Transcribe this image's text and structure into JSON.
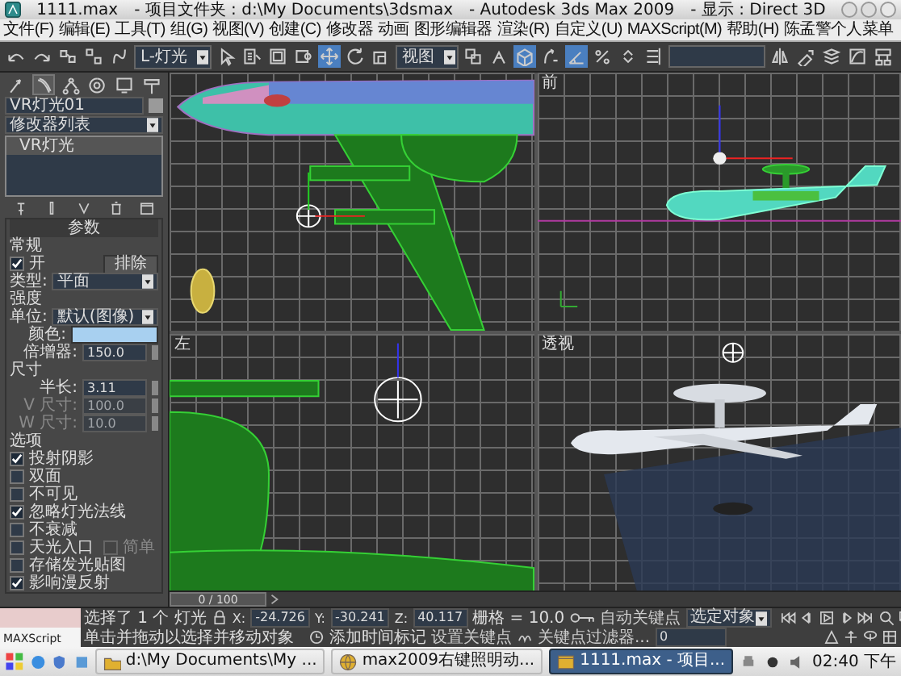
{
  "window": {
    "title_parts": [
      "1111.max",
      "- 项目文件夹 : d:\\My Documents\\3dsmax",
      "- Autodesk 3ds Max  2009",
      "- 显示 : Direct 3D"
    ]
  },
  "menu": [
    "文件(F)",
    "编辑(E)",
    "工具(T)",
    "组(G)",
    "视图(V)",
    "创建(C)",
    "修改器",
    "动画",
    "图形编辑器",
    "渲染(R)",
    "自定义(U)",
    "MAXScript(M)",
    "帮助(H)",
    "陈孟警个人菜单"
  ],
  "toolbar": [
    {
      "kind": "undo",
      "selected": false
    },
    {
      "kind": "redo",
      "selected": false
    },
    {
      "kind": "link",
      "selected": false
    },
    {
      "kind": "unlink",
      "selected": false
    },
    {
      "kind": "bind",
      "selected": false
    },
    {
      "kind": "dropdown",
      "value": "L-灯光"
    },
    {
      "kind": "select",
      "selected": false
    },
    {
      "kind": "select-name",
      "selected": false
    },
    {
      "kind": "region",
      "selected": false
    },
    {
      "kind": "window",
      "selected": false
    },
    {
      "kind": "move",
      "selected": true
    },
    {
      "kind": "rotate",
      "selected": false
    },
    {
      "kind": "scale",
      "selected": false
    },
    {
      "kind": "dropdown",
      "value": "视图"
    },
    {
      "kind": "pivot",
      "selected": false
    },
    {
      "kind": "manipulate",
      "selected": false
    },
    {
      "kind": "keyboard",
      "selected": true
    },
    {
      "kind": "snap",
      "selected": false
    },
    {
      "kind": "angle-snap",
      "selected": true
    },
    {
      "kind": "percent-snap",
      "selected": false
    },
    {
      "kind": "spinner-snap",
      "selected": false
    },
    {
      "kind": "edit-named",
      "selected": false
    },
    {
      "kind": "field"
    },
    {
      "kind": "mirror",
      "selected": false
    },
    {
      "kind": "align",
      "selected": false
    },
    {
      "kind": "layer",
      "selected": false
    },
    {
      "kind": "curve",
      "selected": false
    },
    {
      "kind": "schematic",
      "selected": false
    }
  ],
  "command_panel": {
    "tabs": [
      {
        "kind": "create",
        "selected": false
      },
      {
        "kind": "modify",
        "selected": true
      },
      {
        "kind": "hierarchy",
        "selected": false
      },
      {
        "kind": "motion",
        "selected": false
      },
      {
        "kind": "display",
        "selected": false
      },
      {
        "kind": "utilities",
        "selected": false
      }
    ],
    "object_name": "VR灯光01",
    "modifier_list": "修改器列表",
    "stack": [
      {
        "label": "VR灯光"
      }
    ],
    "rollout": "参数",
    "general": {
      "heading": "常规",
      "on": {
        "label": "开",
        "checked": true
      },
      "exclude": "排除",
      "type_label": "类型:",
      "type": "平面"
    },
    "intensity": {
      "heading": "强度",
      "units_label": "单位:",
      "units": "默认(图像)",
      "color_label": "颜色:",
      "color": "#a8d0f0",
      "multiplier_label": "倍增器:",
      "multiplier": "150.0"
    },
    "size": {
      "heading": "尺寸",
      "fields": [
        {
          "label": "半长:",
          "value": "3.11",
          "disabled": false
        },
        {
          "label": "V 尺寸:",
          "value": "100.0",
          "disabled": true
        },
        {
          "label": "W 尺寸:",
          "value": "10.0",
          "disabled": true
        }
      ]
    },
    "options": {
      "heading": "选项",
      "items": [
        {
          "label": "投射阴影",
          "checked": true
        },
        {
          "label": "双面",
          "checked": false
        },
        {
          "label": "不可见",
          "checked": false
        },
        {
          "label": "忽略灯光法线",
          "checked": true
        },
        {
          "label": "不衰减",
          "checked": false
        },
        {
          "label": "天光入口",
          "checked": false,
          "extra": {
            "label": "简单",
            "checked": false,
            "disabled": true
          }
        },
        {
          "label": "存储发光贴图",
          "checked": false
        },
        {
          "label": "影响漫反射",
          "checked": true
        }
      ]
    }
  },
  "viewports": [
    {
      "kind": "top"
    },
    {
      "kind": "front",
      "label": "前"
    },
    {
      "kind": "left",
      "label": "左"
    },
    {
      "kind": "perspective",
      "label": "透视"
    }
  ],
  "timeline": {
    "label": "0 / 100",
    "level": 0
  },
  "listener": "MAXScript",
  "status": {
    "selection": "选择了 1 个 灯光",
    "prompt": "单击并拖动以选择并移动对象",
    "coords": [
      {
        "label": "X:",
        "value": "-24.726"
      },
      {
        "label": "Y:",
        "value": "-30.241"
      },
      {
        "label": "Z:",
        "value": "40.117"
      }
    ],
    "grid": "栅格 = 10.0",
    "time_tag": "添加时间标记",
    "auto_key": "自动关键点",
    "key_mode": "选定对象",
    "set_key": "设置关键点",
    "key_filters": "关键点过滤器...",
    "frame": "0"
  },
  "taskbar": {
    "tasks": [
      {
        "label": "d:\\My Documents\\My ...",
        "kind": "folder",
        "selected": false
      },
      {
        "label": "max2009右键照明动...",
        "kind": "browser",
        "selected": false
      },
      {
        "label": "1111.max - 项目...",
        "kind": "app",
        "selected": true
      }
    ],
    "clock": "02:40 下午"
  }
}
